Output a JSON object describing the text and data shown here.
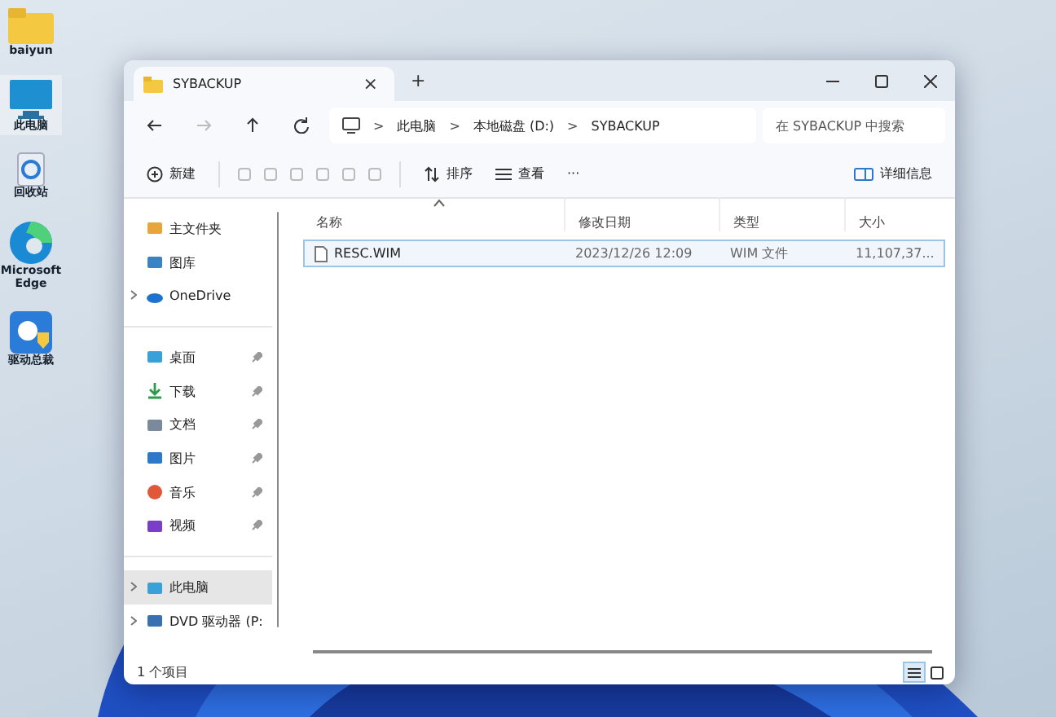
{
  "desktop_icons": [
    {
      "label": "baiyun",
      "selected": false
    },
    {
      "label": "此电脑",
      "selected": true
    },
    {
      "label": "回收站",
      "selected": false
    },
    {
      "label": "Microsoft Edge",
      "selected": false
    },
    {
      "label": "驱动总裁",
      "selected": false
    }
  ],
  "window": {
    "title": "SYBACKUP",
    "tab_close": "×",
    "new_tab": "+"
  },
  "address_bar": {
    "breadcrumb": [
      "此电脑",
      "本地磁盘 (D:)",
      "SYBACKUP"
    ],
    "separator": ">"
  },
  "search": {
    "placeholder": "在 SYBACKUP 中搜索"
  },
  "toolbar": {
    "new": "新建",
    "sort": "排序",
    "view": "查看",
    "more": "···",
    "details": "详细信息"
  },
  "sidebar": {
    "groups": [
      [
        {
          "label": "主文件夹",
          "expandable": false,
          "pinned": false,
          "selected": false
        },
        {
          "label": "图库",
          "expandable": false,
          "pinned": false,
          "selected": false
        },
        {
          "label": "OneDrive",
          "expandable": true,
          "pinned": false,
          "selected": false
        }
      ],
      [
        {
          "label": "桌面",
          "expandable": false,
          "pinned": true,
          "selected": false
        },
        {
          "label": "下载",
          "expandable": false,
          "pinned": true,
          "selected": false
        },
        {
          "label": "文档",
          "expandable": false,
          "pinned": true,
          "selected": false
        },
        {
          "label": "图片",
          "expandable": false,
          "pinned": true,
          "selected": false
        },
        {
          "label": "音乐",
          "expandable": false,
          "pinned": true,
          "selected": false
        },
        {
          "label": "视频",
          "expandable": false,
          "pinned": true,
          "selected": false
        }
      ],
      [
        {
          "label": "此电脑",
          "expandable": true,
          "pinned": false,
          "selected": true
        },
        {
          "label": "DVD 驱动器 (P:",
          "expandable": true,
          "pinned": false,
          "selected": false
        }
      ]
    ]
  },
  "table": {
    "columns": [
      {
        "label": "名称",
        "sorted": true
      },
      {
        "label": "修改日期",
        "sorted": false
      },
      {
        "label": "类型",
        "sorted": false
      },
      {
        "label": "大小",
        "sorted": false
      }
    ],
    "rows": [
      {
        "name": "RESC.WIM",
        "date": "2023/12/26 12:09",
        "type": "WIM 文件",
        "size": "11,107,37...",
        "selected": true
      }
    ]
  },
  "status_bar": {
    "count": "1 个项目",
    "views": [
      {
        "kind": "details",
        "selected": true
      },
      {
        "kind": "tiles",
        "selected": false
      }
    ]
  }
}
